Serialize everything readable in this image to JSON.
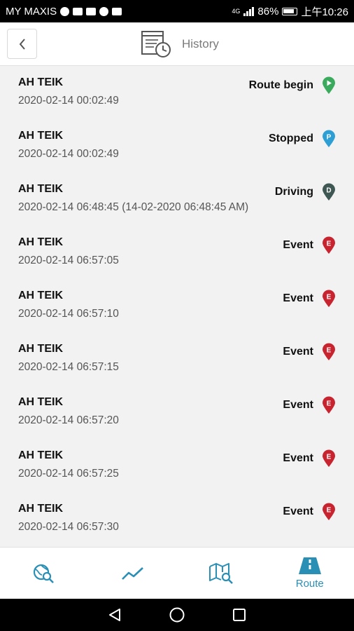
{
  "status_bar": {
    "carrier": "MY MAXIS",
    "network": "4G",
    "battery": "86%",
    "time": "上午10:26"
  },
  "header": {
    "back_icon": "chevron-left-icon",
    "title_icon": "history-clock-icon",
    "title": "History"
  },
  "rows": [
    {
      "name": "AH TEIK",
      "time": "2020-02-14 00:02:49",
      "status": "Route begin",
      "pin_letter": "",
      "pin_type": "play",
      "pin_color": "#3aaa5c"
    },
    {
      "name": "AH TEIK",
      "time": "2020-02-14 00:02:49",
      "status": "Stopped",
      "pin_letter": "P",
      "pin_type": "letter",
      "pin_color": "#2d9fd4"
    },
    {
      "name": "AH TEIK",
      "time": "2020-02-14 06:48:45 (14-02-2020 06:48:45 AM)",
      "status": "Driving",
      "pin_letter": "D",
      "pin_type": "letter",
      "pin_color": "#3f5753"
    },
    {
      "name": "AH TEIK",
      "time": "2020-02-14 06:57:05",
      "status": "Event",
      "pin_letter": "E",
      "pin_type": "letter",
      "pin_color": "#c8242f"
    },
    {
      "name": "AH TEIK",
      "time": "2020-02-14 06:57:10",
      "status": "Event",
      "pin_letter": "E",
      "pin_type": "letter",
      "pin_color": "#c8242f"
    },
    {
      "name": "AH TEIK",
      "time": "2020-02-14 06:57:15",
      "status": "Event",
      "pin_letter": "E",
      "pin_type": "letter",
      "pin_color": "#c8242f"
    },
    {
      "name": "AH TEIK",
      "time": "2020-02-14 06:57:20",
      "status": "Event",
      "pin_letter": "E",
      "pin_type": "letter",
      "pin_color": "#c8242f"
    },
    {
      "name": "AH TEIK",
      "time": "2020-02-14 06:57:25",
      "status": "Event",
      "pin_letter": "E",
      "pin_type": "letter",
      "pin_color": "#c8242f"
    },
    {
      "name": "AH TEIK",
      "time": "2020-02-14 06:57:30",
      "status": "Event",
      "pin_letter": "E",
      "pin_type": "letter",
      "pin_color": "#c8242f"
    }
  ],
  "bottom_nav": {
    "items": [
      {
        "icon": "globe-search-icon",
        "label": ""
      },
      {
        "icon": "trend-line-icon",
        "label": ""
      },
      {
        "icon": "map-search-icon",
        "label": ""
      },
      {
        "icon": "route-road-icon",
        "label": "Route"
      }
    ],
    "accent": "#2a8fb5"
  },
  "android_nav": {
    "icons": [
      "back-triangle-icon",
      "home-circle-icon",
      "recents-square-icon"
    ]
  }
}
